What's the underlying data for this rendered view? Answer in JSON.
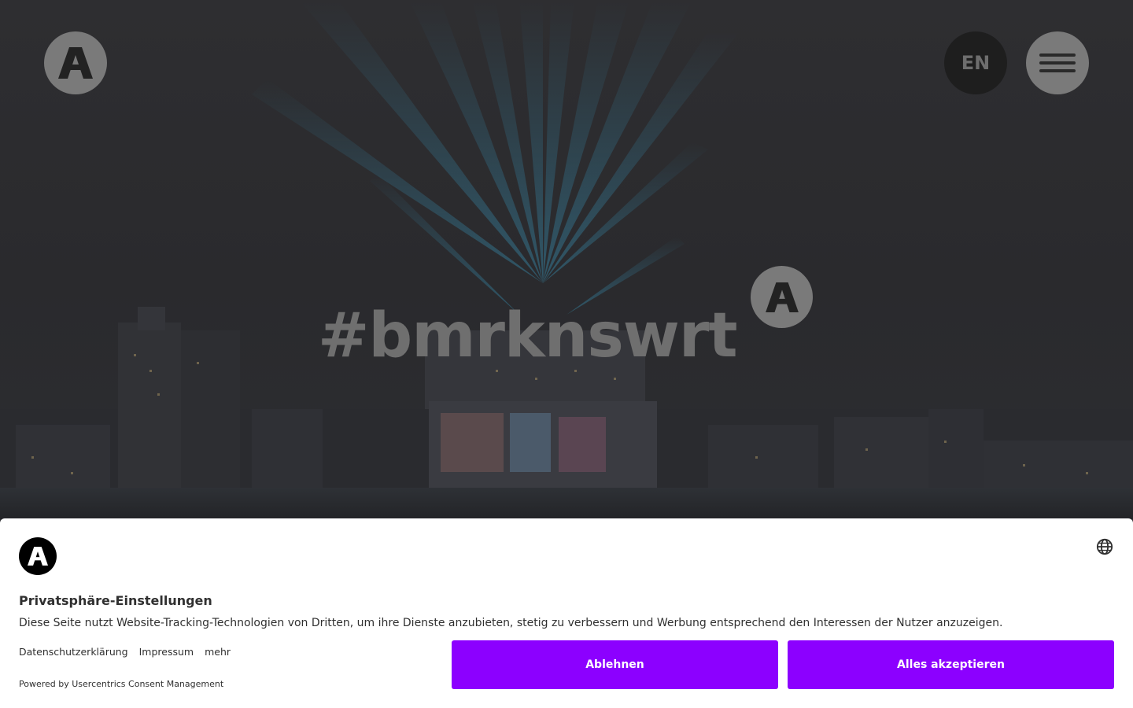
{
  "header": {
    "logo_icon": "brand-a-logo-icon",
    "language_label": "EN",
    "menu_icon": "hamburger-menu-icon"
  },
  "hero": {
    "headline": "#bmrknswrt",
    "badge_icon": "brand-a-logo-icon"
  },
  "consent": {
    "logo_icon": "brand-a-logo-icon",
    "language_icon": "globe-icon",
    "title": "Privatsphäre-Einstellungen",
    "description": "Diese Seite nutzt Website-Tracking-Technologien von Dritten, um ihre Dienste anzubieten, stetig zu verbessern und Werbung entsprechend den Interessen der Nutzer anzuzeigen.",
    "links": {
      "privacy": "Datenschutzerklärung",
      "imprint": "Impressum",
      "more": "mehr"
    },
    "powered_by": "Powered by Usercentrics Consent Management",
    "deny_label": "Ablehnen",
    "accept_label": "Alles akzeptieren",
    "button_color": "#8c00ff"
  }
}
